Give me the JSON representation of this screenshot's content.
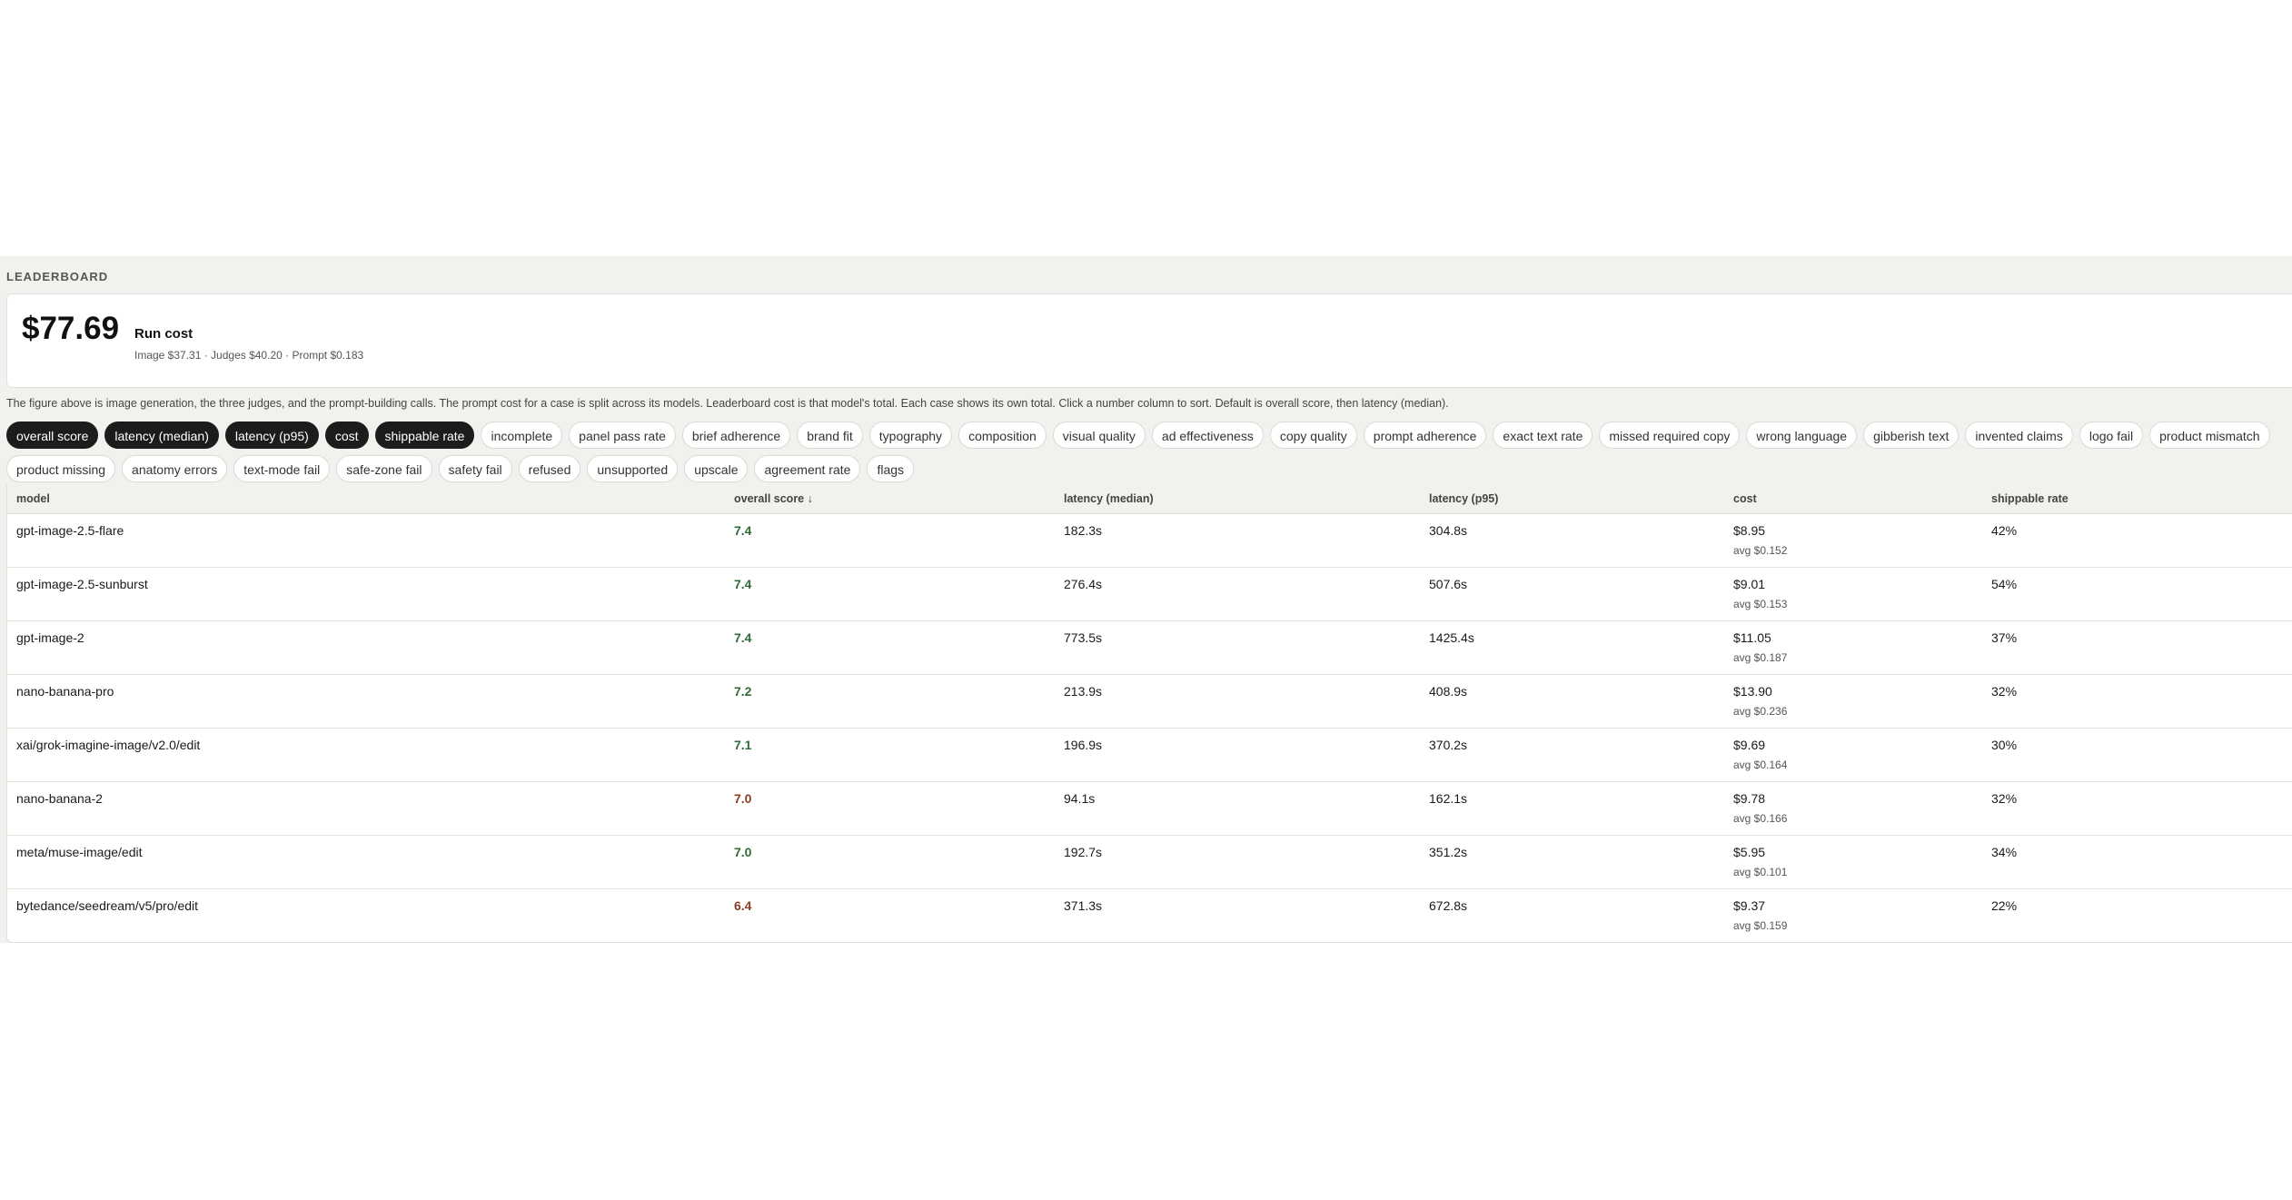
{
  "section_label": "LEADERBOARD",
  "run_cost": {
    "amount": "$77.69",
    "title": "Run cost",
    "breakdown": "Image $37.31 · Judges $40.20 · Prompt $0.183"
  },
  "note": "The figure above is image generation, the three judges, and the prompt-building calls. The prompt cost for a case is split across its models. Leaderboard cost is that model's total. Each case shows its own total. Click a number column to sort. Default is overall score, then latency (median).",
  "colors": {
    "active_chip": "#1c1c1c",
    "score_good": "#2f6b3a",
    "score_warn": "#8a3d24",
    "panel_bg": "#f2f1ee"
  },
  "chips": [
    {
      "label": "overall score",
      "active": true
    },
    {
      "label": "latency (median)",
      "active": true
    },
    {
      "label": "latency (p95)",
      "active": true
    },
    {
      "label": "cost",
      "active": true
    },
    {
      "label": "shippable rate",
      "active": true
    },
    {
      "label": "incomplete",
      "active": false
    },
    {
      "label": "panel pass rate",
      "active": false
    },
    {
      "label": "brief adherence",
      "active": false
    },
    {
      "label": "brand fit",
      "active": false
    },
    {
      "label": "typography",
      "active": false
    },
    {
      "label": "composition",
      "active": false
    },
    {
      "label": "visual quality",
      "active": false
    },
    {
      "label": "ad effectiveness",
      "active": false
    },
    {
      "label": "copy quality",
      "active": false
    },
    {
      "label": "prompt adherence",
      "active": false
    },
    {
      "label": "exact text rate",
      "active": false
    },
    {
      "label": "missed required copy",
      "active": false
    },
    {
      "label": "wrong language",
      "active": false
    },
    {
      "label": "gibberish text",
      "active": false
    },
    {
      "label": "invented claims",
      "active": false
    },
    {
      "label": "logo fail",
      "active": false
    },
    {
      "label": "product mismatch",
      "active": false
    },
    {
      "label": "product missing",
      "active": false
    },
    {
      "label": "anatomy errors",
      "active": false
    },
    {
      "label": "text-mode fail",
      "active": false
    },
    {
      "label": "safe-zone fail",
      "active": false
    },
    {
      "label": "safety fail",
      "active": false
    },
    {
      "label": "refused",
      "active": false
    },
    {
      "label": "unsupported",
      "active": false
    },
    {
      "label": "upscale",
      "active": false
    },
    {
      "label": "agreement rate",
      "active": false
    },
    {
      "label": "flags",
      "active": false
    }
  ],
  "table": {
    "headers": {
      "model": "model",
      "overall_score": "overall score ↓",
      "latency_median": "latency (median)",
      "latency_p95": "latency (p95)",
      "cost": "cost",
      "shippable_rate": "shippable rate"
    },
    "rows": [
      {
        "model": "gpt-image-2.5-flare",
        "score": "7.4",
        "score_tone": "good",
        "latency_median": "182.3s",
        "latency_p95": "304.8s",
        "cost": "$8.95",
        "cost_avg": "avg $0.152",
        "shippable": "42%"
      },
      {
        "model": "gpt-image-2.5-sunburst",
        "score": "7.4",
        "score_tone": "good",
        "latency_median": "276.4s",
        "latency_p95": "507.6s",
        "cost": "$9.01",
        "cost_avg": "avg $0.153",
        "shippable": "54%"
      },
      {
        "model": "gpt-image-2",
        "score": "7.4",
        "score_tone": "good",
        "latency_median": "773.5s",
        "latency_p95": "1425.4s",
        "cost": "$11.05",
        "cost_avg": "avg $0.187",
        "shippable": "37%"
      },
      {
        "model": "nano-banana-pro",
        "score": "7.2",
        "score_tone": "good",
        "latency_median": "213.9s",
        "latency_p95": "408.9s",
        "cost": "$13.90",
        "cost_avg": "avg $0.236",
        "shippable": "32%"
      },
      {
        "model": "xai/grok-imagine-image/v2.0/edit",
        "score": "7.1",
        "score_tone": "good",
        "latency_median": "196.9s",
        "latency_p95": "370.2s",
        "cost": "$9.69",
        "cost_avg": "avg $0.164",
        "shippable": "30%"
      },
      {
        "model": "nano-banana-2",
        "score": "7.0",
        "score_tone": "warn",
        "latency_median": "94.1s",
        "latency_p95": "162.1s",
        "cost": "$9.78",
        "cost_avg": "avg $0.166",
        "shippable": "32%"
      },
      {
        "model": "meta/muse-image/edit",
        "score": "7.0",
        "score_tone": "good",
        "latency_median": "192.7s",
        "latency_p95": "351.2s",
        "cost": "$5.95",
        "cost_avg": "avg $0.101",
        "shippable": "34%"
      },
      {
        "model": "bytedance/seedream/v5/pro/edit",
        "score": "6.4",
        "score_tone": "warn",
        "latency_median": "371.3s",
        "latency_p95": "672.8s",
        "cost": "$9.37",
        "cost_avg": "avg $0.159",
        "shippable": "22%"
      }
    ]
  }
}
